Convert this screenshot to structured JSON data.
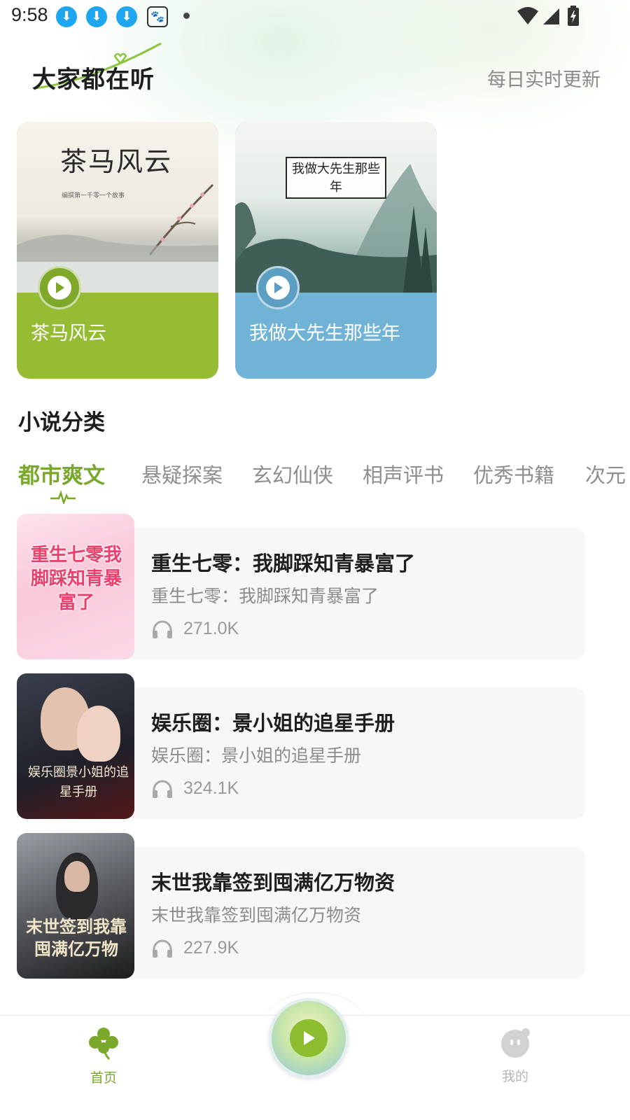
{
  "status_bar": {
    "time": "9:58"
  },
  "header": {
    "title": "大家都在听",
    "subtitle": "每日实时更新"
  },
  "featured": [
    {
      "cover_text": "茶马风云",
      "cover_small_text": "编撰第一千零一个故事",
      "title": "茶马风云",
      "color": "#95bc33"
    },
    {
      "cover_text": "我做大先生那些年",
      "title": "我做大先生那些年",
      "color": "#70b3d6"
    }
  ],
  "categories": {
    "section_title": "小说分类",
    "tabs": [
      "都市爽文",
      "悬疑探案",
      "玄幻仙侠",
      "相声评书",
      "优秀书籍",
      "次元"
    ],
    "active_tab": "都市爽文",
    "accent_color": "#7aa82b"
  },
  "books": [
    {
      "cover_text": "重生七零我脚踩知青暴富了",
      "title": "重生七零：我脚踩知青暴富了",
      "subtitle": "重生七零：我脚踩知青暴富了",
      "listens": "271.0K"
    },
    {
      "cover_text": "娱乐圈景小姐的追星手册",
      "title": "娱乐圈：景小姐的追星手册",
      "subtitle": "娱乐圈：景小姐的追星手册",
      "listens": "324.1K"
    },
    {
      "cover_text": "末世签到我靠囤满亿万物",
      "title": "末世我靠签到囤满亿万物资",
      "subtitle": "末世我靠签到囤满亿万物资",
      "listens": "227.9K"
    }
  ],
  "bottom_nav": {
    "home_label": "首页",
    "mine_label": "我的"
  }
}
